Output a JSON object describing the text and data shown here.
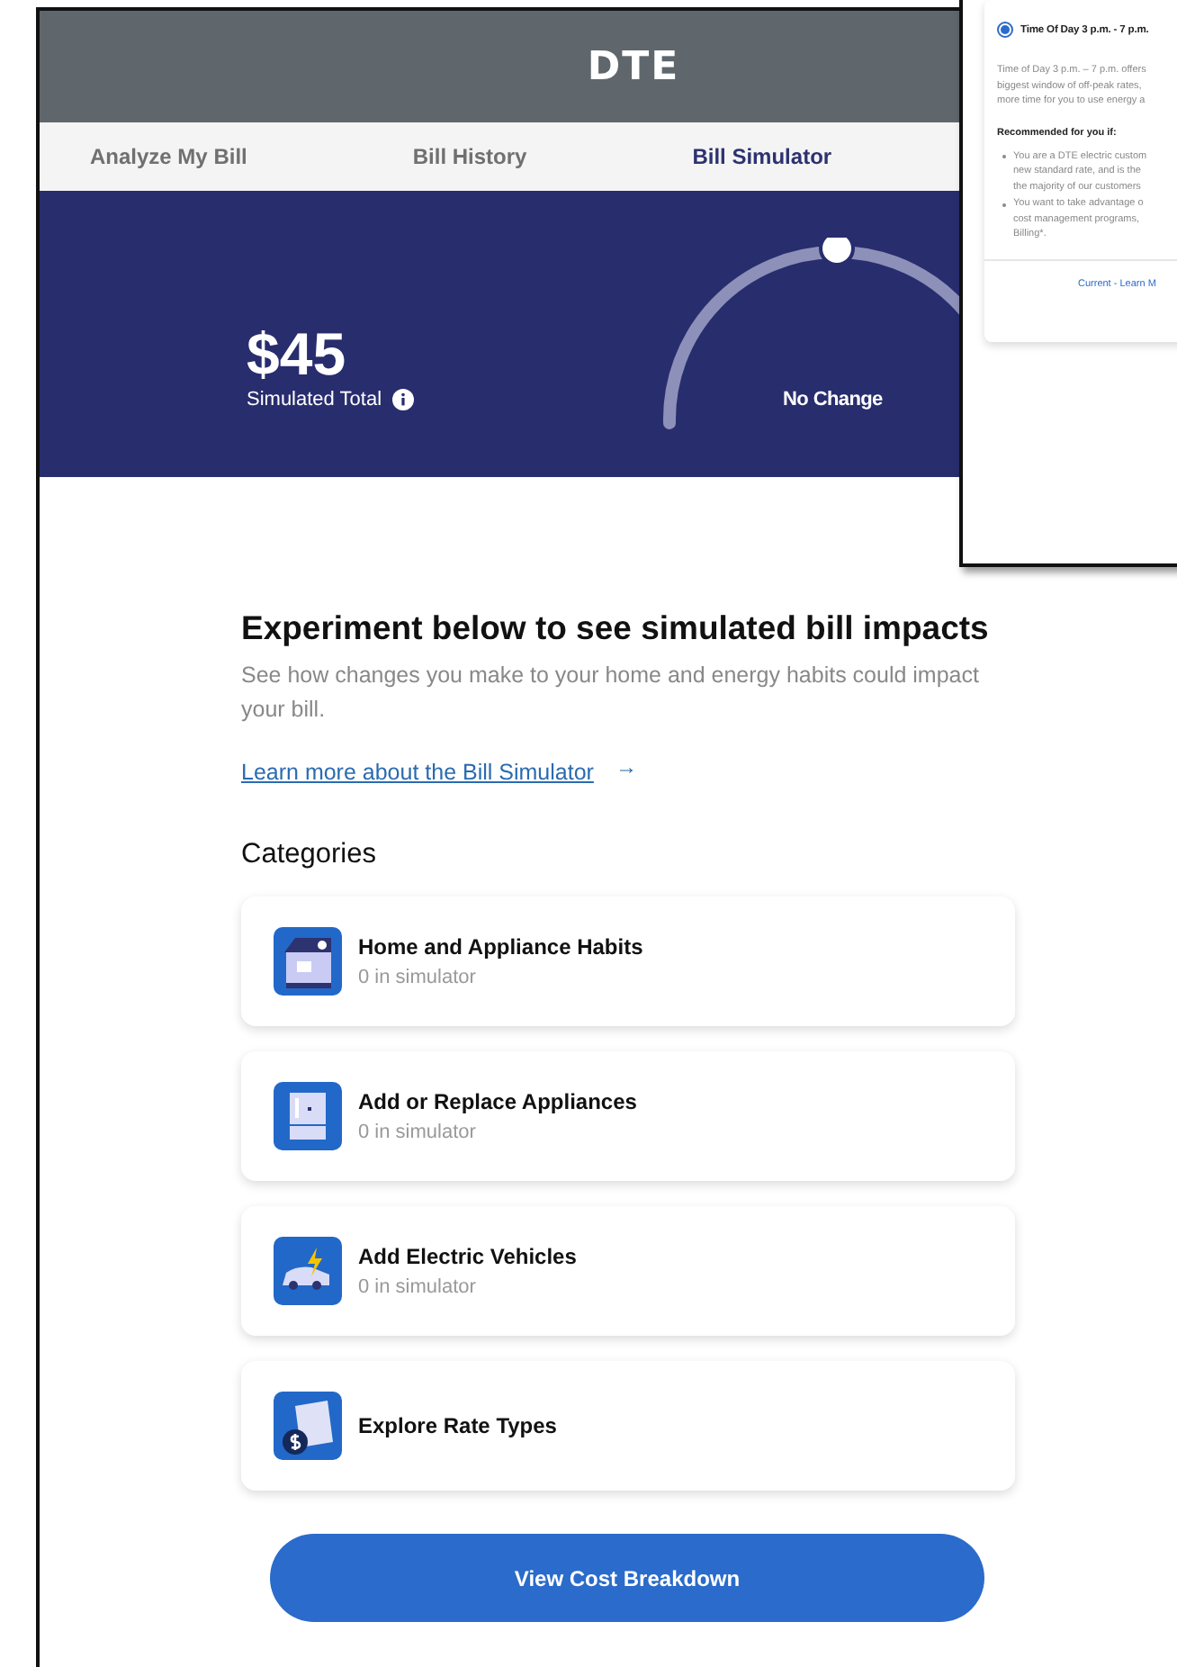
{
  "header": {
    "logo": "DTE"
  },
  "tabs": [
    {
      "label": "Analyze My Bill",
      "selected": false
    },
    {
      "label": "Bill History",
      "selected": false
    },
    {
      "label": "Bill Simulator",
      "selected": true
    }
  ],
  "summary": {
    "amount": "$45",
    "label": "Simulated Total",
    "gauge_label": "No Change"
  },
  "intro": {
    "title": "Experiment below to see simulated bill impacts",
    "description": "See how changes you make to your home and energy habits could impact your bill.",
    "link": "Learn more about the Bill Simulator",
    "link_arrow": "→"
  },
  "categories": {
    "title": "Categories",
    "items": [
      {
        "kind": "house",
        "title": "Home and Appliance Habits",
        "count": "0 in simulator"
      },
      {
        "kind": "fridge",
        "title": "Add or Replace Appliances",
        "count": "0 in simulator"
      },
      {
        "kind": "car",
        "title": "Add Electric Vehicles",
        "count": "0 in simulator"
      },
      {
        "kind": "rate",
        "title": "Explore Rate Types"
      }
    ]
  },
  "button": "View Cost Breakdown",
  "rate_option": {
    "title": "Time Of Day 3 p.m. - 7 p.m.",
    "selected": true,
    "description_lines": [
      "Time of Day 3 p.m. – 7 p.m. offers",
      "biggest window of off-peak rates,",
      "more time for you to use energy a"
    ],
    "recommended_title": "Recommended for you if:",
    "bullets": [
      {
        "lines": [
          "You are a DTE electric custom",
          "new standard rate, and is the",
          "the majority of our customers"
        ]
      },
      {
        "lines": [
          "You want to take advantage o",
          "cost management programs,",
          "Billing*."
        ]
      }
    ],
    "footer_link": "Current - Learn M"
  }
}
